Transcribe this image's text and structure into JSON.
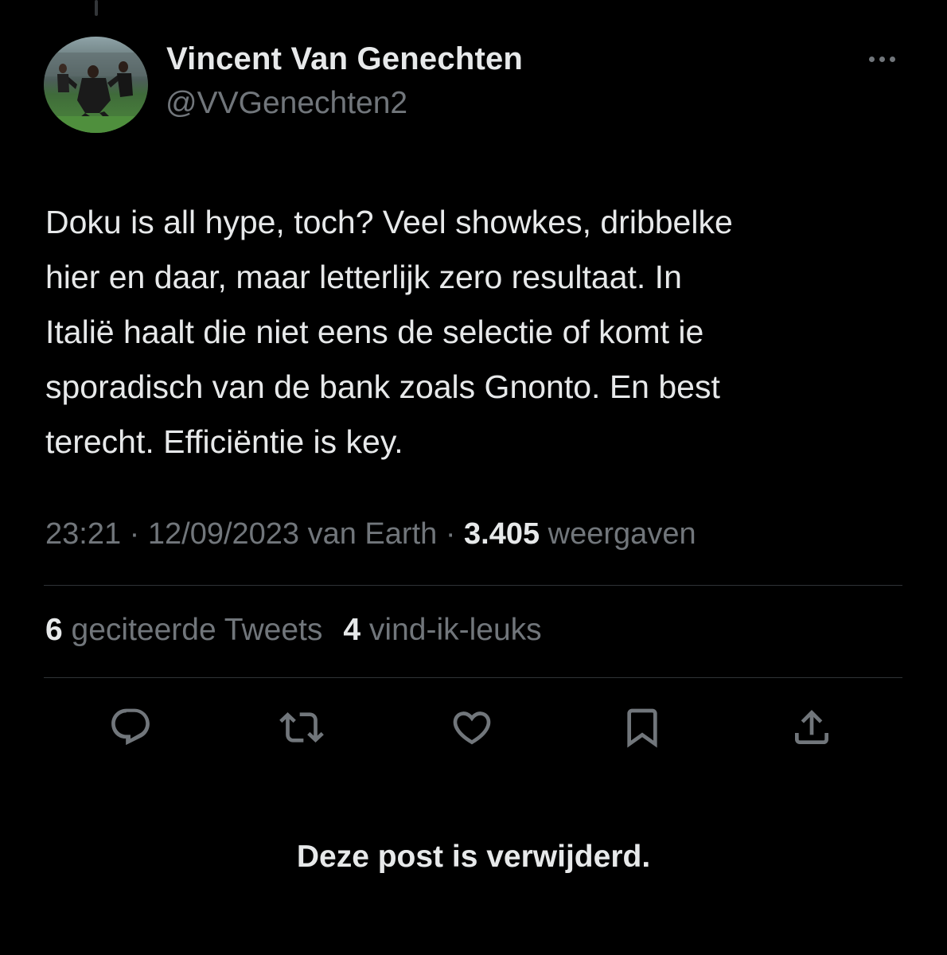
{
  "author": {
    "display_name": "Vincent Van Genechten",
    "handle": "@VVGenechten2"
  },
  "tweet": {
    "text": "Doku is all hype, toch? Veel showkes, dribbelke\nhier en daar, maar letterlijk zero resultaat. In\nItalië haalt die niet eens de selectie of komt ie\nsporadisch van de bank zoals Gnonto. En best\nterecht. Efficiëntie is key.",
    "timestamp": "23:21 · 12/09/2023 van Earth · ",
    "views_count": "3.405",
    "views_label": " weergaven"
  },
  "stats": {
    "quote_count": "6",
    "quote_label": "geciteerde Tweets",
    "like_count": "4",
    "like_label": "vind-ik-leuks"
  },
  "actions": {
    "icons": [
      "reply-icon",
      "retweet-icon",
      "like-icon",
      "bookmark-icon",
      "share-icon"
    ],
    "icon_color": "#71767b"
  },
  "notice": {
    "text": "Deze post is verwijderd."
  },
  "colors": {
    "background": "#000000",
    "primary_text": "#e7e9ea",
    "secondary_text": "#71767b",
    "divider": "#2f3336"
  }
}
